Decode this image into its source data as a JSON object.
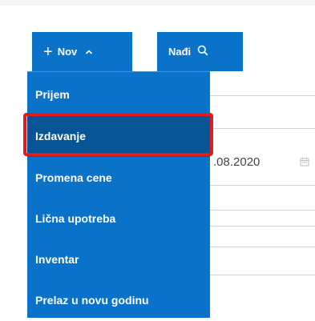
{
  "toolbar": {
    "new_label": "Nov",
    "new_plus": "+",
    "search_label": "Nađi"
  },
  "form": {
    "date_value": ".08.2020"
  },
  "menu": {
    "items": [
      {
        "label": "Prijem"
      },
      {
        "label": "Izdavanje",
        "selected": true
      },
      {
        "label": "Promena cene"
      },
      {
        "label": "Lična upotreba"
      },
      {
        "label": "Inventar"
      },
      {
        "label": "Prelaz u novu godinu"
      }
    ]
  },
  "colors": {
    "primary": "#0a73c9",
    "selected": "#075597",
    "highlight": "#e21b1b"
  },
  "icons": {
    "new": "plus-icon",
    "dropdown": "chevron-up-icon",
    "search": "search-icon",
    "date": "calendar-icon"
  }
}
